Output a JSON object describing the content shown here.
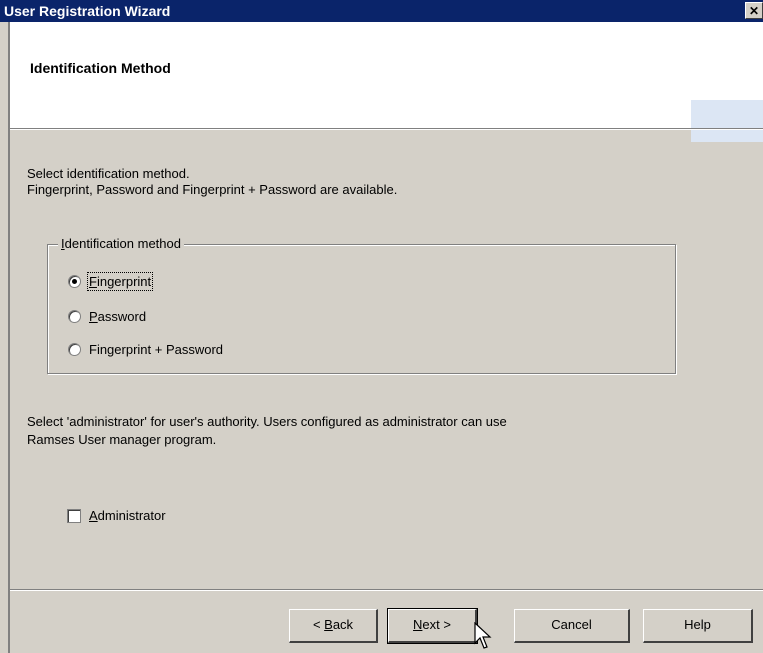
{
  "window": {
    "title": "User Registration Wizard",
    "close_glyph": "✕"
  },
  "header": {
    "page_title": "Identification Method"
  },
  "instructions": {
    "line1": "Select identification method.",
    "line2": "Fingerprint, Password and Fingerprint + Password are available."
  },
  "identification_group": {
    "label_mnemonic": "I",
    "label_rest": "dentification method",
    "options": [
      {
        "mnemonic": "F",
        "rest": "ingerprint",
        "checked": true
      },
      {
        "mnemonic": "P",
        "rest": "assword",
        "checked": false
      },
      {
        "label": "Fingerprint + Password",
        "checked": false
      }
    ]
  },
  "authority": {
    "line1": "Select 'administrator' for user's authority. Users configured as administrator can use",
    "line2": "Ramses User manager program."
  },
  "administrator_checkbox": {
    "mnemonic": "A",
    "rest": "dministrator",
    "checked": false
  },
  "buttons": {
    "back": {
      "prefix": "< ",
      "mnemonic": "B",
      "rest": "ack"
    },
    "next": {
      "mnemonic": "N",
      "rest": "ext >"
    },
    "cancel": "Cancel",
    "help": "Help"
  },
  "icons": {
    "close": "close-icon",
    "cursor": "mouse-pointer-icon"
  }
}
